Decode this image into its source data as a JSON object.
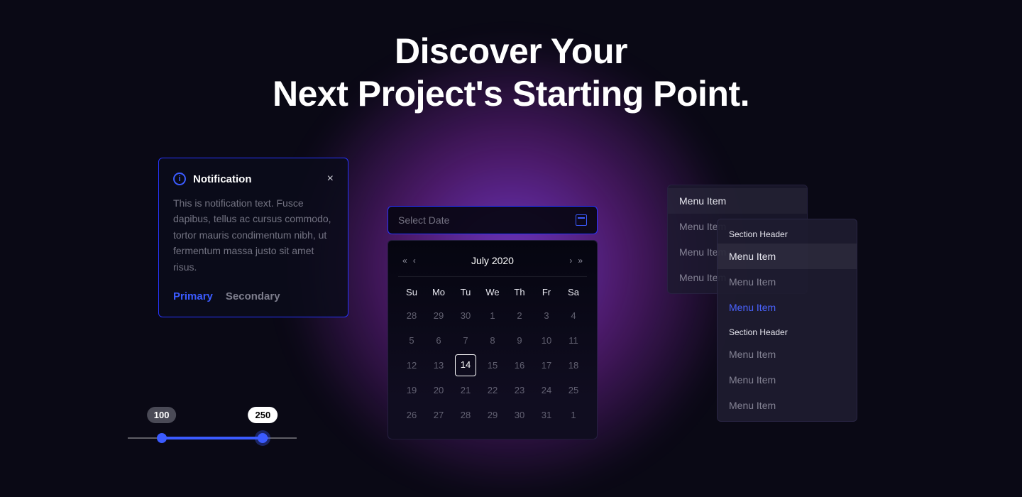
{
  "heading": {
    "line1": "Discover Your",
    "line2": "Next Project's Starting Point."
  },
  "notification": {
    "title": "Notification",
    "body": "This is notification text. Fusce dapibus, tellus ac cursus commodo, tortor mauris condimentum nibh, ut fermentum massa justo sit amet risus.",
    "primary_label": "Primary",
    "secondary_label": "Secondary"
  },
  "slider": {
    "value_low": "100",
    "value_high": "250"
  },
  "date": {
    "placeholder": "Select Date",
    "month": "July 2020",
    "dow": [
      "Su",
      "Mo",
      "Tu",
      "We",
      "Th",
      "Fr",
      "Sa"
    ],
    "days": [
      "28",
      "29",
      "30",
      "1",
      "2",
      "3",
      "4",
      "5",
      "6",
      "7",
      "8",
      "9",
      "10",
      "11",
      "12",
      "13",
      "14",
      "15",
      "16",
      "17",
      "18",
      "19",
      "20",
      "21",
      "22",
      "23",
      "24",
      "25",
      "26",
      "27",
      "28",
      "29",
      "30",
      "31",
      "1"
    ],
    "selected_index": 16
  },
  "menu1": {
    "items": [
      "Menu Item",
      "Menu Item",
      "Menu Item",
      "Menu Item"
    ],
    "highlight_index": 0
  },
  "menu2": {
    "items": [
      {
        "type": "header",
        "label": "Section Header"
      },
      {
        "type": "item",
        "label": "Menu Item",
        "selected": true
      },
      {
        "type": "item",
        "label": "Menu Item"
      },
      {
        "type": "item",
        "label": "Menu Item",
        "link": true
      },
      {
        "type": "header",
        "label": "Section Header"
      },
      {
        "type": "item",
        "label": "Menu Item"
      },
      {
        "type": "item",
        "label": "Menu Item"
      },
      {
        "type": "item",
        "label": "Menu Item"
      }
    ]
  }
}
